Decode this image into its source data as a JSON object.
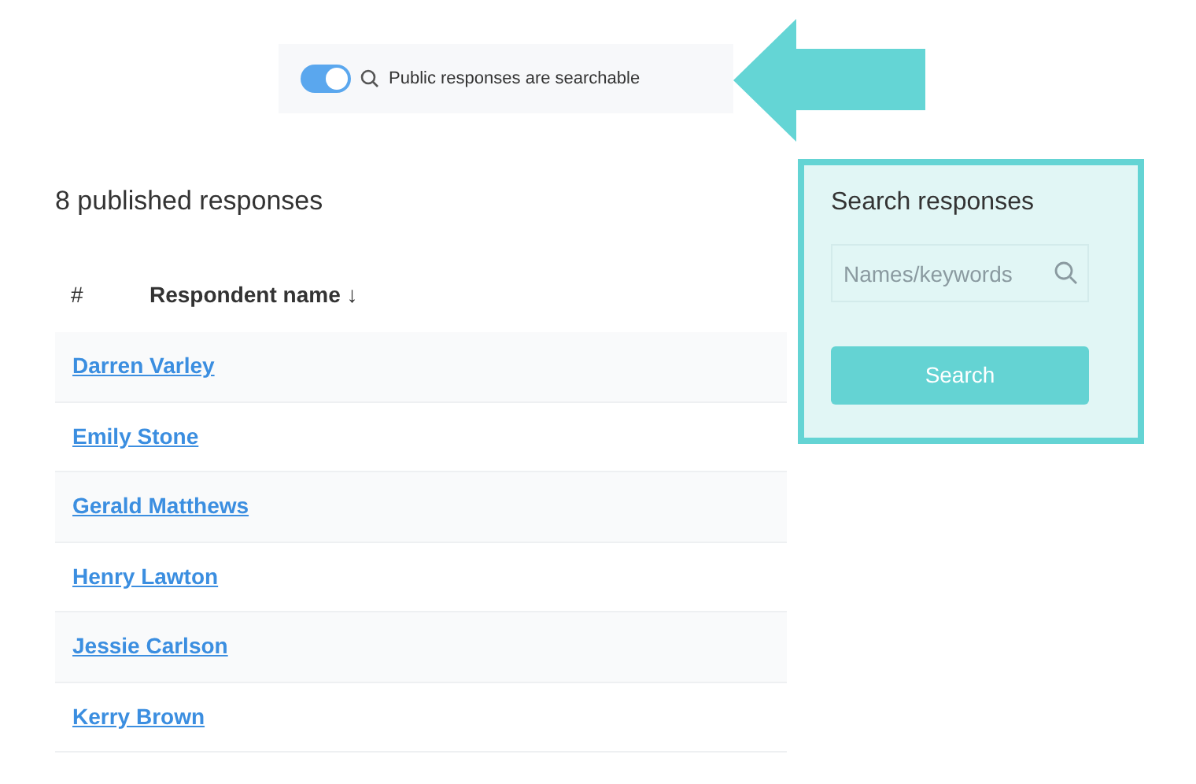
{
  "toggle_bar": {
    "on": true,
    "label": "Public responses are searchable"
  },
  "heading": "8 published responses",
  "table": {
    "columns": [
      "#",
      "Respondent name ↓"
    ],
    "rows": [
      {
        "name": "Darren Varley"
      },
      {
        "name": "Emily Stone"
      },
      {
        "name": "Gerald Matthews"
      },
      {
        "name": "Henry Lawton"
      },
      {
        "name": "Jessie Carlson"
      },
      {
        "name": "Kerry Brown"
      }
    ]
  },
  "search_panel": {
    "title": "Search responses",
    "placeholder": "Names/keywords",
    "button": "Search"
  }
}
